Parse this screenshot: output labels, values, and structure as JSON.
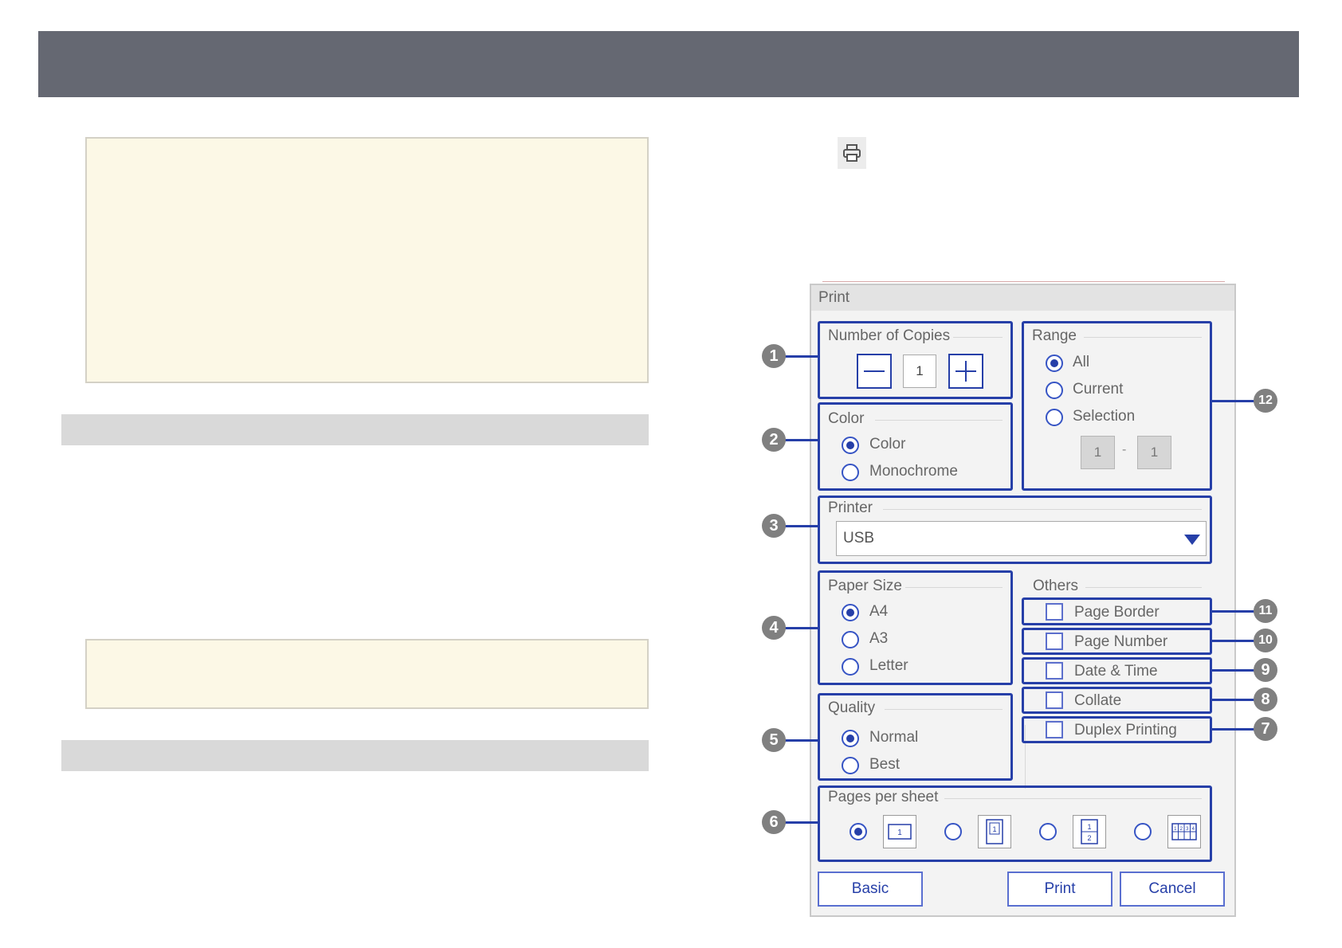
{
  "dialog": {
    "title": "Print",
    "copies": {
      "label": "Number of Copies",
      "value": "1"
    },
    "color": {
      "label": "Color",
      "options": [
        "Color",
        "Monochrome"
      ],
      "selected": "Color"
    },
    "printer": {
      "label": "Printer",
      "value": "USB"
    },
    "paper_size": {
      "label": "Paper Size",
      "options": [
        "A4",
        "A3",
        "Letter"
      ],
      "selected": "A4"
    },
    "quality": {
      "label": "Quality",
      "options": [
        "Normal",
        "Best"
      ],
      "selected": "Normal"
    },
    "pages_per_sheet": {
      "label": "Pages per sheet",
      "selected_index": 0,
      "icons": [
        [
          "1"
        ],
        [
          "1"
        ],
        [
          "1",
          "2"
        ],
        [
          "1",
          "2",
          "3",
          "4"
        ]
      ]
    },
    "range": {
      "label": "Range",
      "options": [
        "All",
        "Current",
        "Selection"
      ],
      "selected": "All",
      "from": "1",
      "separator": "-",
      "to": "1"
    },
    "others": {
      "label": "Others",
      "items": [
        "Page Border",
        "Page Number",
        "Date & Time",
        "Collate",
        "Duplex Printing"
      ]
    },
    "buttons": {
      "basic": "Basic",
      "print": "Print",
      "cancel": "Cancel"
    }
  },
  "callouts": {
    "copies": "1",
    "color": "2",
    "printer": "3",
    "paper_size": "4",
    "quality": "5",
    "pages_per_sheet": "6",
    "duplex": "7",
    "collate": "8",
    "date_time": "9",
    "page_number": "10",
    "page_border": "11",
    "range": "12"
  },
  "colors": {
    "accent": "#263fa8",
    "header": "#656872",
    "note_bg": "#fcf8e6",
    "badge": "#808080"
  },
  "icons": {
    "toolbar": "printer-icon"
  }
}
